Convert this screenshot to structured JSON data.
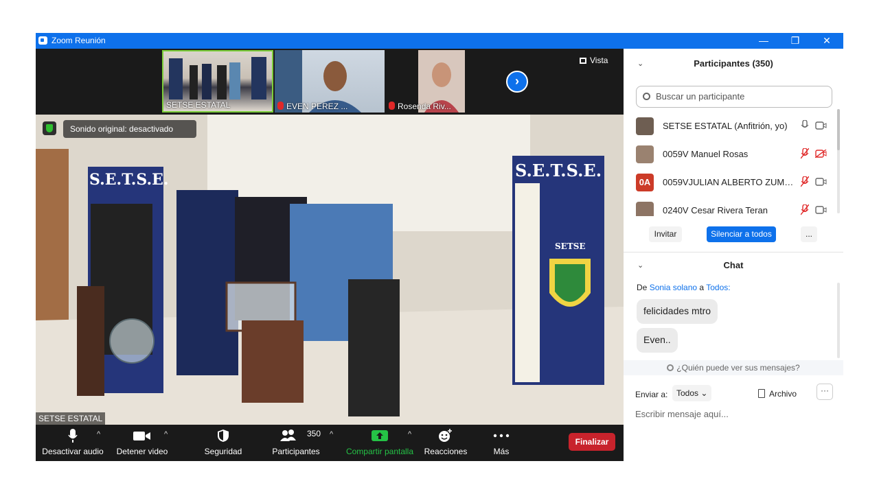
{
  "window": {
    "title": "Zoom Reunión",
    "minimize": "—",
    "maximize": "❐",
    "close": "✕"
  },
  "thumbnails": [
    {
      "name": "SETSE ESTATAL",
      "muted": false
    },
    {
      "name": "EVEN PEREZ ...",
      "muted": true
    },
    {
      "name": "Rosenda Riv...",
      "muted": true
    }
  ],
  "vista_label": "Vista",
  "next_arrow": "›",
  "main_video": {
    "sound_notice": "Sonido original: desactivado",
    "speaker_name": "SETSE ESTATAL"
  },
  "toolbar": {
    "audio": "Desactivar audio",
    "video": "Detener video",
    "security": "Seguridad",
    "participants": "Participantes",
    "participants_count": "350",
    "share": "Compartir pantalla",
    "reactions": "Reacciones",
    "more": "Más",
    "end": "Finalizar",
    "caret": "^"
  },
  "participants": {
    "header": "Participantes (350)",
    "search_placeholder": "Buscar un participante",
    "rows": [
      {
        "name": "SETSE ESTATAL (Anfitrión, yo)",
        "avatar": "",
        "muted": false
      },
      {
        "name": "0059V Manuel Rosas",
        "avatar": "",
        "muted": true
      },
      {
        "name": "0059VJULIAN ALBERTO ZUMAYA...",
        "avatar": "0A",
        "muted": true
      },
      {
        "name": "0240V Cesar Rivera Teran",
        "avatar": "",
        "muted": true
      }
    ],
    "invite": "Invitar",
    "mute_all": "Silenciar a todos",
    "more": "..."
  },
  "chat": {
    "header": "Chat",
    "from_prefix": "De",
    "from_sender": "Sonia solano",
    "from_mid": "a",
    "from_to": "Todos:",
    "messages": [
      "felicidades mtro",
      "Even.."
    ],
    "who_can_see": "¿Quién puede ver sus mensajes?",
    "send_to_label": "Enviar a:",
    "send_to_value": "Todos",
    "file": "Archivo",
    "more": "···",
    "input_placeholder": "Escribir mensaje aquí..."
  },
  "colors": {
    "accent": "#0e71eb",
    "end": "#c8232c",
    "share": "#25c246",
    "muted": "#e02828"
  }
}
